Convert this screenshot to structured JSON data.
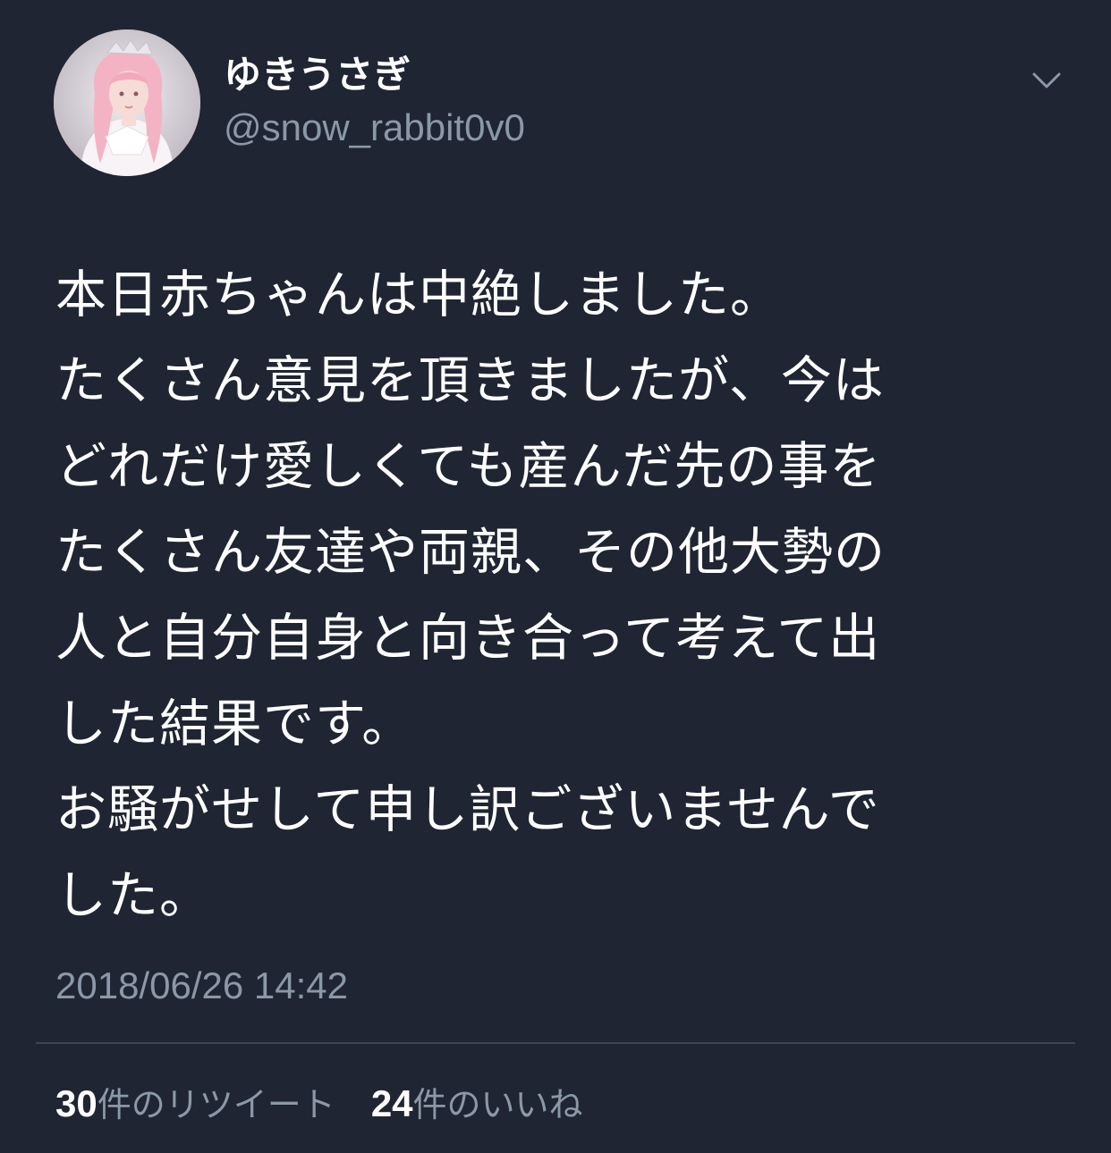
{
  "user": {
    "display_name": "ゆきうさぎ",
    "handle": "@snow_rabbit0v0",
    "avatar_icon": "profile-photo"
  },
  "header": {
    "menu_icon": "chevron-down-icon"
  },
  "tweet": {
    "lines": [
      "本日赤ちゃんは中絶しました。",
      "たくさん意見を頂きましたが、今は",
      "どれだけ愛しくても産んだ先の事を",
      "たくさん友達や両親、その他大勢の",
      "人と自分自身と向き合って考えて出",
      "した結果です。",
      "お騒がせして申し訳ございませんで",
      "した。"
    ],
    "timestamp": "2018/06/26 14:42"
  },
  "stats": {
    "retweets": {
      "count": "30",
      "label": "件のリツイート"
    },
    "likes": {
      "count": "24",
      "label": "件のいいね"
    }
  },
  "colors": {
    "background": "#1f2532",
    "primary_text": "#ffffff",
    "secondary_text": "#8b98a8",
    "divider": "#3d4656"
  }
}
